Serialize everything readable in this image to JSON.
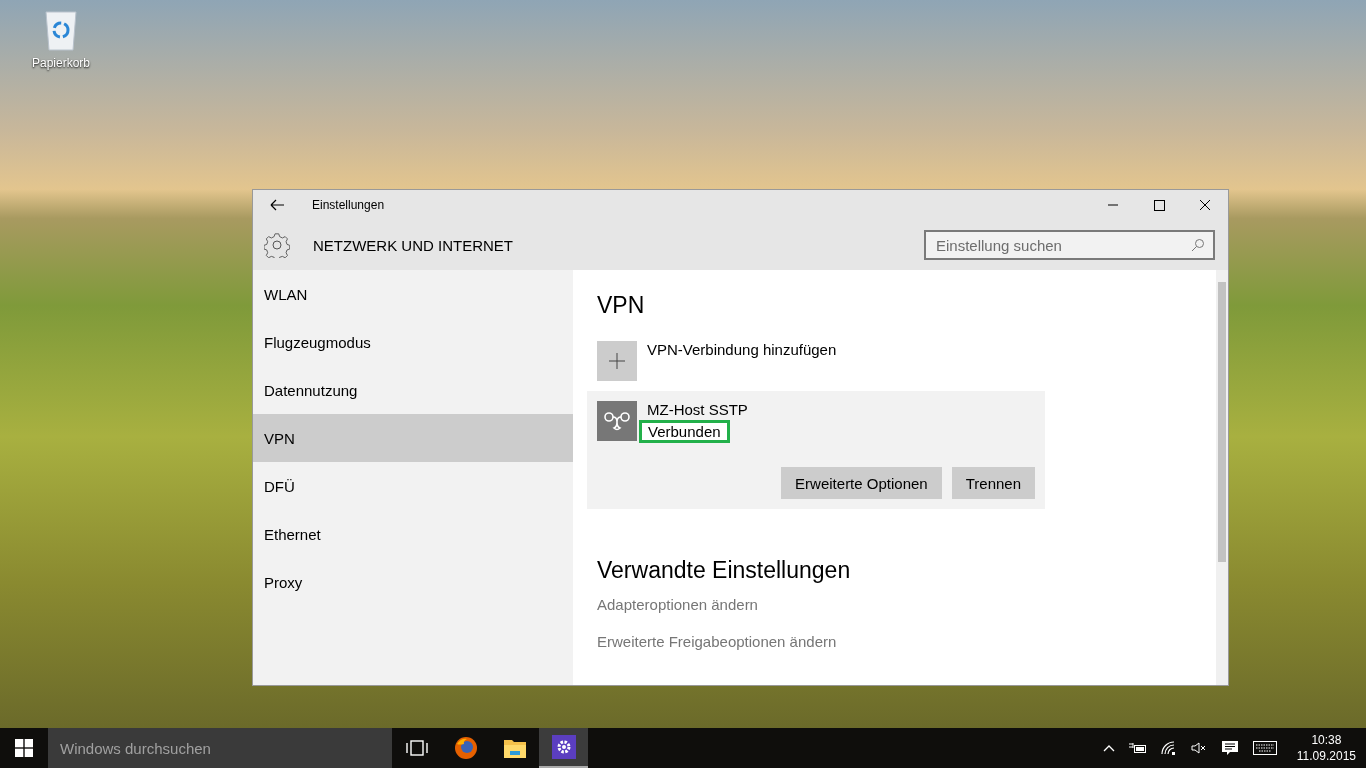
{
  "desktop": {
    "icons": [
      {
        "label": "Papierkorb"
      }
    ]
  },
  "window": {
    "title": "Einstellungen",
    "heading": "NETZWERK UND INTERNET",
    "search": {
      "placeholder": "Einstellung suchen"
    },
    "sidebar": {
      "items": [
        {
          "label": "WLAN",
          "selected": false
        },
        {
          "label": "Flugzeugmodus",
          "selected": false
        },
        {
          "label": "Datennutzung",
          "selected": false
        },
        {
          "label": "VPN",
          "selected": true
        },
        {
          "label": "DFÜ",
          "selected": false
        },
        {
          "label": "Ethernet",
          "selected": false
        },
        {
          "label": "Proxy",
          "selected": false
        }
      ]
    },
    "content": {
      "title": "VPN",
      "add_label": "VPN-Verbindung hinzufügen",
      "connections": [
        {
          "name": "MZ-Host SSTP",
          "status": "Verbunden",
          "highlighted": true,
          "buttons": [
            "Erweiterte Optionen",
            "Trennen"
          ]
        }
      ],
      "related_title": "Verwandte Einstellungen",
      "related_links": [
        "Adapteroptionen ändern",
        "Erweiterte Freigabeoptionen ändern"
      ]
    }
  },
  "taskbar": {
    "search": {
      "placeholder": "Windows durchsuchen"
    },
    "apps": [
      {
        "kind": "task-view",
        "selected": false
      },
      {
        "kind": "browser",
        "selected": false
      },
      {
        "kind": "folder",
        "selected": false
      },
      {
        "kind": "settings",
        "selected": true
      }
    ],
    "time": "10:38",
    "date": "11.09.2015"
  }
}
